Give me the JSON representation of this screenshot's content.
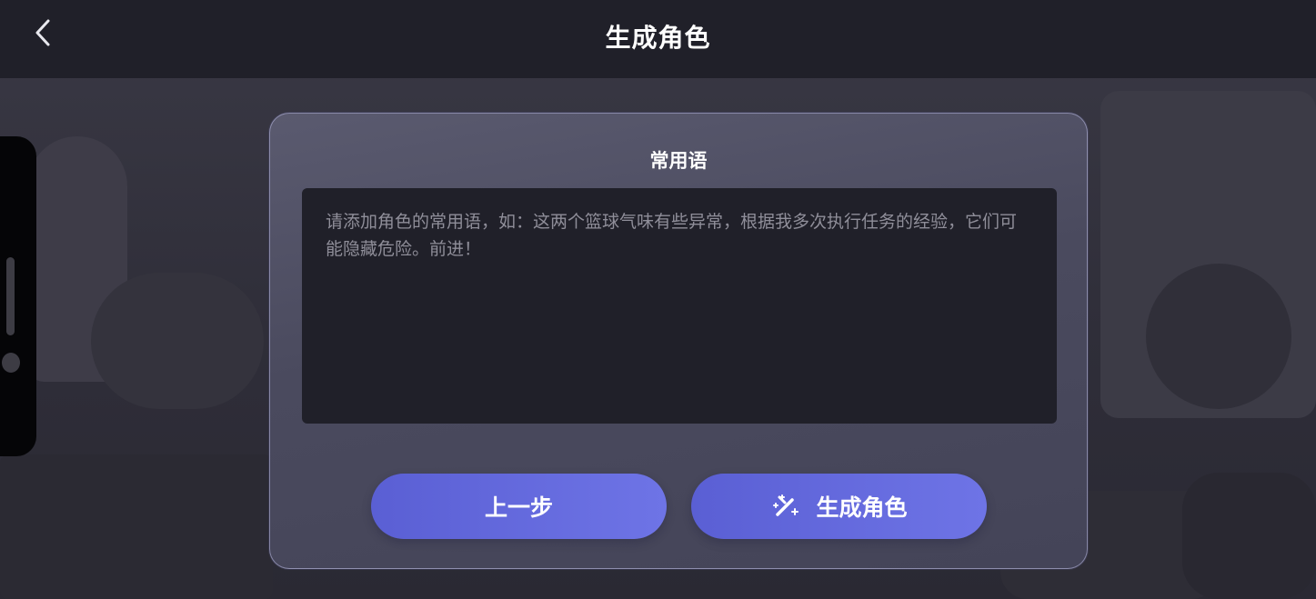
{
  "header": {
    "title": "生成角色"
  },
  "dialog": {
    "title": "常用语",
    "textarea_placeholder": "请添加角色的常用语，如：这两个篮球气味有些异常，根据我多次执行任务的经验，它们可能隐藏危险。前进！"
  },
  "buttons": {
    "prev_label": "上一步",
    "generate_label": "生成角色"
  },
  "icons": {
    "back": "chevron-left-icon",
    "generate": "magic-wand-icon"
  },
  "colors": {
    "accent": "#6268dc",
    "topbar": "#202029",
    "dialog": "#4e4e62"
  }
}
